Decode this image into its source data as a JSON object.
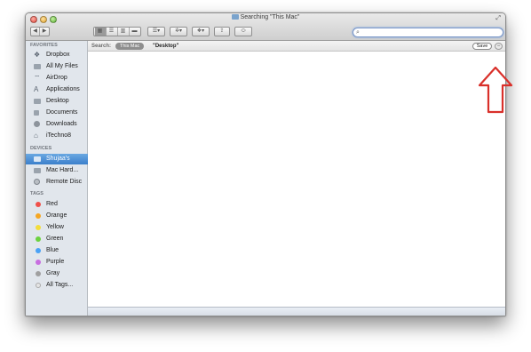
{
  "window": {
    "title": "Searching \"This Mac\""
  },
  "toolbar": {
    "back_icon": "chevron-left-icon",
    "forward_icon": "chevron-right-icon",
    "view_modes": [
      "icon-view-icon",
      "list-view-icon",
      "column-view-icon",
      "cover-flow-icon"
    ],
    "arrange_icon": "arrange-menu-icon",
    "action_icon": "gear-icon",
    "share_icon": "share-icon",
    "tag_icon": "tag-icon",
    "dropbox_icon": "dropbox-icon",
    "search_icon": "magnifier-icon",
    "search_value": ""
  },
  "sidebar": {
    "favorites_heading": "FAVORITES",
    "favorites": [
      {
        "label": "Dropbox",
        "icon": "dropbox-icon"
      },
      {
        "label": "All My Files",
        "icon": "all-files-icon"
      },
      {
        "label": "AirDrop",
        "icon": "airdrop-icon"
      },
      {
        "label": "Applications",
        "icon": "applications-icon"
      },
      {
        "label": "Desktop",
        "icon": "desktop-icon"
      },
      {
        "label": "Documents",
        "icon": "documents-icon"
      },
      {
        "label": "Downloads",
        "icon": "downloads-icon"
      },
      {
        "label": "iTechno8",
        "icon": "home-icon"
      }
    ],
    "devices_heading": "DEVICES",
    "devices": [
      {
        "label": "Shujaa's",
        "icon": "laptop-icon",
        "selected": true
      },
      {
        "label": "Mac Hard...",
        "icon": "hard-disk-icon"
      },
      {
        "label": "Remote Disc",
        "icon": "disc-icon"
      }
    ],
    "tags_heading": "TAGS",
    "tags": [
      {
        "label": "Red",
        "color": "#f0504a"
      },
      {
        "label": "Orange",
        "color": "#f5a623"
      },
      {
        "label": "Yellow",
        "color": "#f3dd3a"
      },
      {
        "label": "Green",
        "color": "#6cd23f"
      },
      {
        "label": "Blue",
        "color": "#4aa2f5"
      },
      {
        "label": "Purple",
        "color": "#c86ee0"
      },
      {
        "label": "Gray",
        "color": "#a0a0a0"
      },
      {
        "label": "All Tags...",
        "color": "#d0d0d0"
      }
    ]
  },
  "scopebar": {
    "label": "Search:",
    "scope_this_mac": "This Mac",
    "scope_desktop": "\"Desktop\"",
    "save_label": "Save",
    "remove_label": "−"
  },
  "annotation": {
    "arrow_color": "#d9302a",
    "arrow_icon": "up-arrow-icon"
  }
}
